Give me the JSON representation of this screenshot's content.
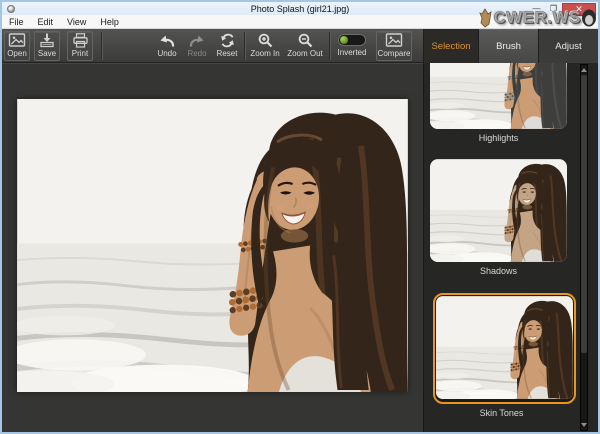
{
  "window": {
    "title": "Photo Splash (girl21.jpg)",
    "controls": {
      "minimize": "—",
      "maximize": "❐",
      "close": "✕"
    }
  },
  "watermark": {
    "text": "CWER.WS"
  },
  "menu": {
    "items": [
      {
        "label": "File"
      },
      {
        "label": "Edit"
      },
      {
        "label": "View"
      },
      {
        "label": "Help"
      }
    ]
  },
  "toolbar": {
    "items": [
      {
        "label": "Open"
      },
      {
        "label": "Save"
      },
      {
        "label": "Print"
      },
      {
        "label": "Undo"
      },
      {
        "label": "Redo",
        "disabled": true
      },
      {
        "label": "Reset"
      },
      {
        "label": "Zoom In"
      },
      {
        "label": "Zoom Out"
      },
      {
        "label": "Inverted",
        "toggle_state": "on"
      },
      {
        "label": "Compare"
      }
    ]
  },
  "tabs": {
    "items": [
      {
        "label": "Selection",
        "active": true
      },
      {
        "label": "Brush",
        "active": false
      },
      {
        "label": "Adjust",
        "active": false
      }
    ]
  },
  "panel": {
    "thumbnails": [
      {
        "label": "Highlights",
        "selected": false
      },
      {
        "label": "Shadows",
        "selected": false
      },
      {
        "label": "Skin Tones",
        "selected": true
      }
    ]
  },
  "colors": {
    "accent_orange": "#e8961e",
    "tab_active_text": "#dd9232",
    "close_button_red": "#c85050",
    "toggle_green": "#6f9e2e",
    "toolbar_dark": "#3b3b39",
    "panel_dark": "#262624",
    "window_border_blue": "#a4c6e4"
  }
}
